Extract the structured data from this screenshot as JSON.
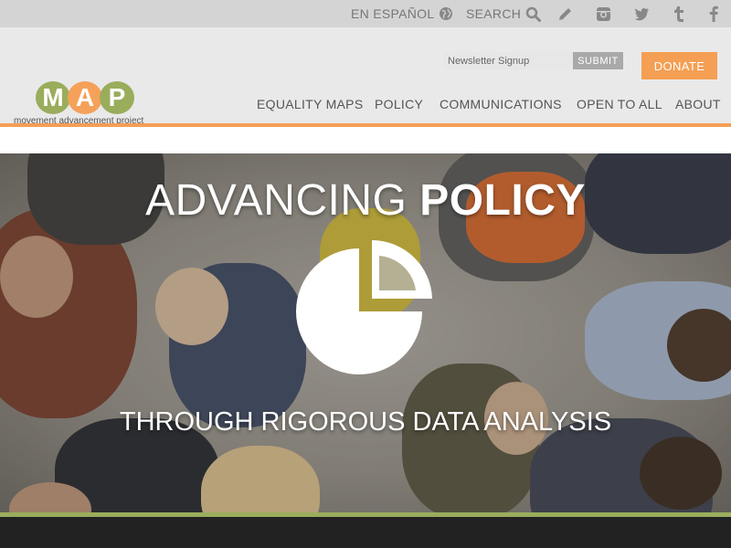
{
  "topbar": {
    "espanol_label": "EN ESPAÑOL",
    "search_label": "SEARCH",
    "social": [
      "pencil-icon",
      "instagram-icon",
      "twitter-icon",
      "tumblr-icon",
      "facebook-icon"
    ]
  },
  "header": {
    "newsletter_placeholder": "Newsletter Signup",
    "submit_label": "SUBMIT",
    "donate_label": "DONATE"
  },
  "logo": {
    "letters": [
      "M",
      "A",
      "P"
    ],
    "tagline": "movement advancement project"
  },
  "nav": {
    "items": [
      "EQUALITY MAPS",
      "POLICY",
      "COMMUNICATIONS",
      "OPEN TO ALL",
      "ABOUT"
    ]
  },
  "hero": {
    "title_light": "ADVANCING ",
    "title_bold": "POLICY",
    "subtitle": "THROUGH RIGOROUS DATA ANALYSIS",
    "icon": "pie-chart-icon"
  },
  "colors": {
    "accent_orange": "#f49f53",
    "accent_green": "#9aad5c",
    "topbar_gray": "#d4d4d4"
  }
}
